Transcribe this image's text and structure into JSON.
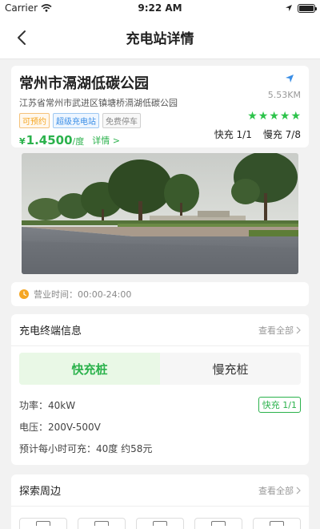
{
  "status_bar": {
    "carrier": "Carrier",
    "time": "9:22 AM"
  },
  "nav": {
    "title": "充电站详情"
  },
  "station": {
    "name": "常州市滆湖低碳公园",
    "distance": "5.53KM",
    "address": "江苏省常州市武进区镇塘桥滆湖低碳公园",
    "tags": [
      "可预约",
      "超级充电站",
      "免费停车"
    ],
    "rating_stars": 5,
    "currency": "¥",
    "price": "1.4500",
    "price_unit": "/度",
    "detail_link": "详情 >",
    "fast_count": "快充 1/1",
    "slow_count": "慢充 7/8"
  },
  "hours": {
    "text": "营业时间：00:00-24:00"
  },
  "terminal": {
    "title": "充电终端信息",
    "view_all": "查看全部",
    "tabs": [
      "快充桩",
      "慢充桩"
    ],
    "power": "功率：40kW",
    "voltage": "电压：200V-500V",
    "estimate": "预计每小时可充：40度  约58元",
    "badge": "快充 1/1"
  },
  "explore": {
    "title": "探索周边",
    "view_all": "查看全部"
  },
  "colors": {
    "accent": "#2bb24c",
    "orange": "#f5a623",
    "blue": "#3a8ee6"
  }
}
